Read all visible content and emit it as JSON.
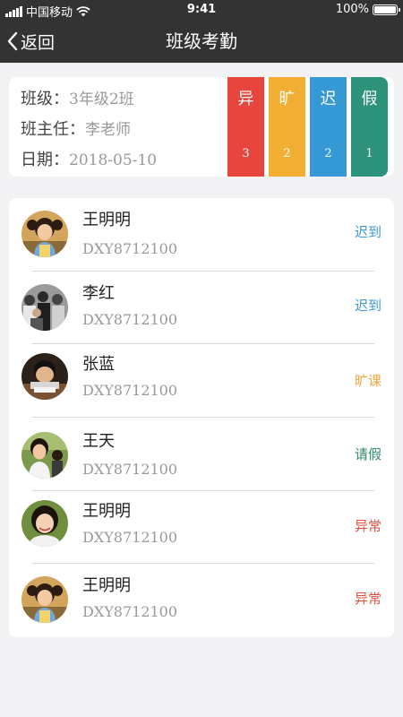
{
  "status_bar": {
    "carrier": "中国移动",
    "time": "9:41",
    "battery": "100%",
    "battery_level": 1.0
  },
  "nav": {
    "back_label": "返回",
    "title": "班级考勤"
  },
  "class_info": {
    "class_label": "班级：",
    "class_value": "3年级2班",
    "teacher_label": "班主任：",
    "teacher_value": "李老师",
    "date_label": "日期：",
    "date_value": "2018-05-10"
  },
  "stats": [
    {
      "label": "异",
      "count": "3",
      "color": "#e8453e"
    },
    {
      "label": "旷",
      "count": "2",
      "color": "#f1ae32"
    },
    {
      "label": "迟",
      "count": "2",
      "color": "#3599d5"
    },
    {
      "label": "假",
      "count": "1",
      "color": "#2d927a"
    }
  ],
  "students": [
    {
      "name": "王明明",
      "id": "DXY8712100",
      "status": "迟到",
      "status_color": "#3f9ad1",
      "avatar": "girl-pigtails-avatar"
    },
    {
      "name": "李红",
      "id": "DXY8712100",
      "status": "迟到",
      "status_color": "#3f9ad1",
      "avatar": "crowd-avatar"
    },
    {
      "name": "张蓝",
      "id": "DXY8712100",
      "status": "旷课",
      "status_color": "#e9a93c",
      "avatar": "boy-desk-avatar"
    },
    {
      "name": "王天",
      "id": "DXY8712100",
      "status": "请假",
      "status_color": "#2f8c6e",
      "avatar": "girl-park-avatar"
    },
    {
      "name": "王明明",
      "id": "DXY8712100",
      "status": "异常",
      "status_color": "#e0503f",
      "avatar": "girl-smiling-avatar"
    },
    {
      "name": "王明明",
      "id": "DXY8712100",
      "status": "异常",
      "status_color": "#e0503f",
      "avatar": "girl-pigtails-avatar"
    }
  ]
}
